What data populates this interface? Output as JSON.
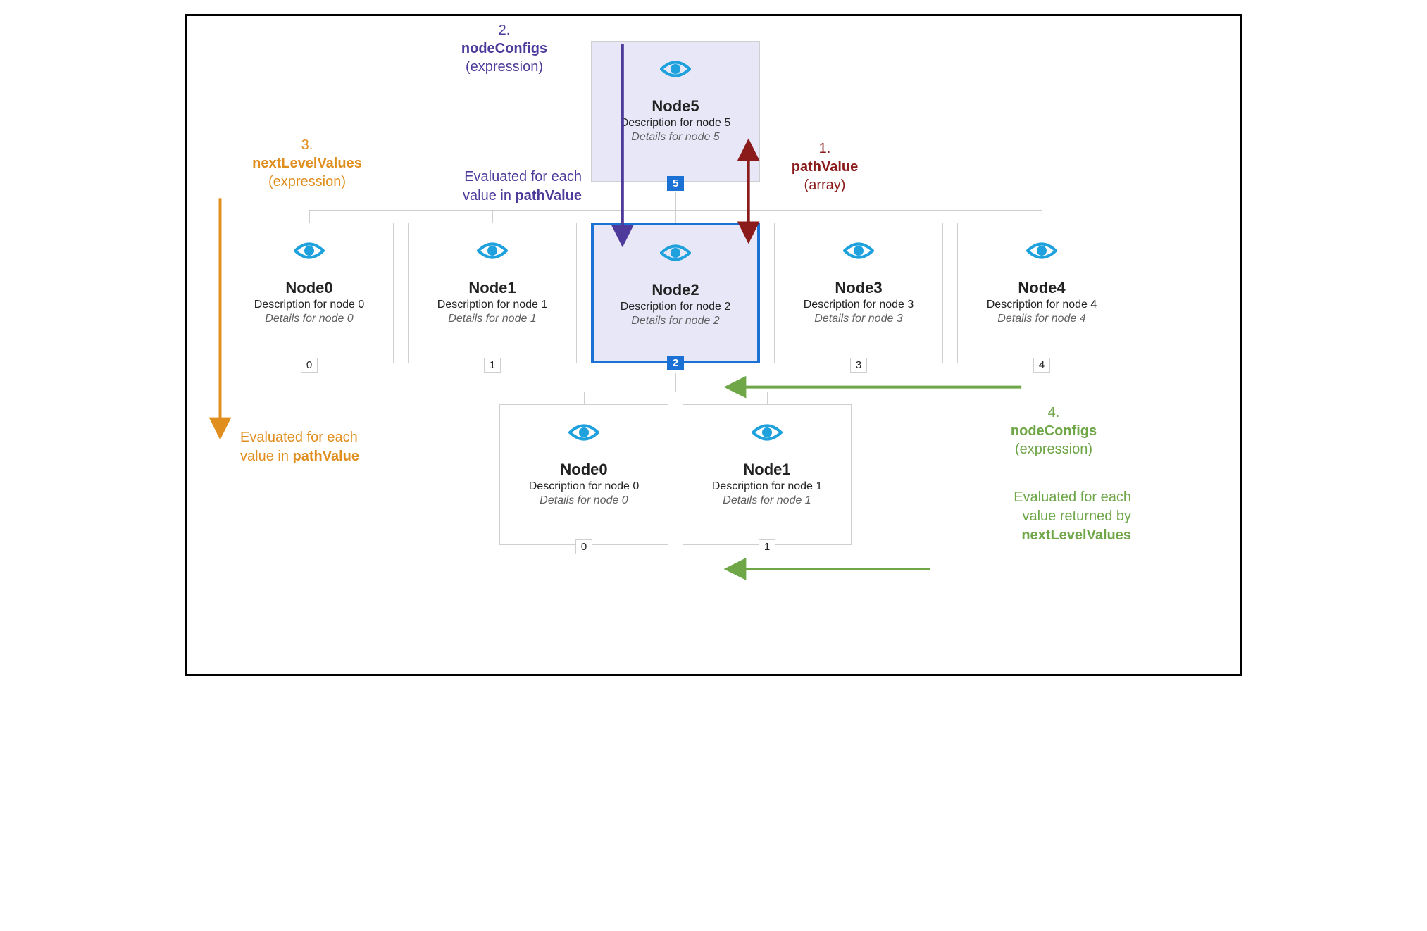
{
  "diagram": {
    "topNode": {
      "title": "Node5",
      "desc": "Description for node 5",
      "details": "Details for node 5",
      "badge": "5"
    },
    "row1": [
      {
        "title": "Node0",
        "desc": "Description for node 0",
        "details": "Details for node 0",
        "badge": "0"
      },
      {
        "title": "Node1",
        "desc": "Description for node 1",
        "details": "Details for node 1",
        "badge": "1"
      },
      {
        "title": "Node2",
        "desc": "Description for node 2",
        "details": "Details for node 2",
        "badge": "2"
      },
      {
        "title": "Node3",
        "desc": "Description for node 3",
        "details": "Details for node 3",
        "badge": "3"
      },
      {
        "title": "Node4",
        "desc": "Description for node 4",
        "details": "Details for node 4",
        "badge": "4"
      }
    ],
    "row2": [
      {
        "title": "Node0",
        "desc": "Description for node 0",
        "details": "Details for node 0",
        "badge": "0"
      },
      {
        "title": "Node1",
        "desc": "Description for node 1",
        "details": "Details for node 1",
        "badge": "1"
      }
    ],
    "labels": {
      "l1_num": "1.",
      "l1_term": "pathValue",
      "l1_sub": "(array)",
      "l2_num": "2.",
      "l2_term": "nodeConfigs",
      "l2_sub": "(expression)",
      "l3_num": "3.",
      "l3_term": "nextLevelValues",
      "l3_sub": "(expression)",
      "l4_num": "4.",
      "l4_term": "nodeConfigs",
      "l4_sub": "(expression)"
    },
    "notes": {
      "purple_a": "Evaluated for each",
      "purple_b_pre": "value in ",
      "purple_b_bold": "pathValue",
      "orange_a": "Evaluated for each",
      "orange_b_pre": "value in ",
      "orange_b_bold": "pathValue",
      "green_a": "Evaluated for each",
      "green_b": "value returned by",
      "green_c_bold": "nextLevelValues"
    }
  }
}
